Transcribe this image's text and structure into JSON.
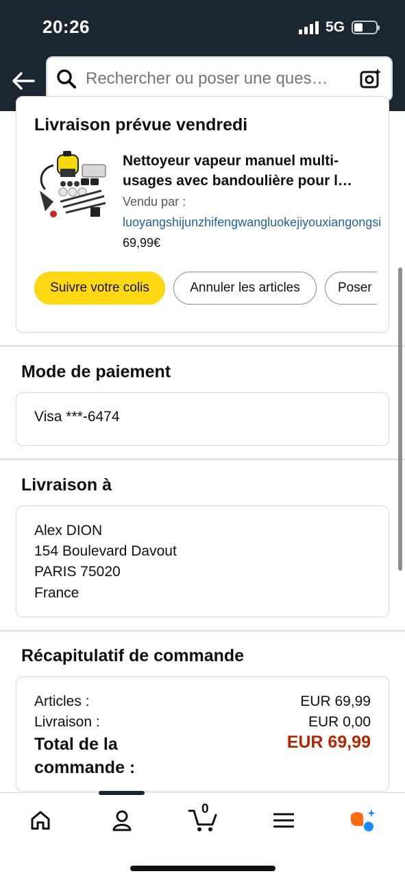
{
  "status": {
    "time": "20:26",
    "network": "5G"
  },
  "header": {
    "search_placeholder": "Rechercher ou poser une ques…"
  },
  "order": {
    "delivery_title": "Livraison prévue vendredi",
    "product_name": "Nettoyeur vapeur manuel multi-usages avec bandoulière pour l…",
    "sold_by_label": "Vendu par  :",
    "seller": "luoyangshijunzhifengwangluokejiyouxiangongsi",
    "price": "69,99€",
    "buttons": {
      "track": "Suivre votre colis",
      "cancel": "Annuler les articles",
      "ask": "Poser"
    }
  },
  "payment": {
    "title": "Mode de paiement",
    "method": "Visa  ***-6474"
  },
  "shipping": {
    "title": "Livraison à",
    "address": [
      "Alex DION",
      "154 Boulevard Davout",
      "PARIS 75020",
      "France"
    ]
  },
  "summary": {
    "title": "Récapitulatif de commande",
    "items_label": "Articles :",
    "items_value": "EUR 69,99",
    "shipping_label": "Livraison :",
    "shipping_value": "EUR 0,00",
    "total_label": "Total de la commande :",
    "total_value": "EUR 69,99"
  },
  "bottom_nav": {
    "cart_count": "0",
    "items": [
      "home-icon",
      "account-icon",
      "cart-icon",
      "menu-icon",
      "rufus-icon"
    ]
  },
  "colors": {
    "header_bg": "#1c2630",
    "primary_button": "#ffd814",
    "link": "#2162a1",
    "total_price": "#b12704"
  }
}
